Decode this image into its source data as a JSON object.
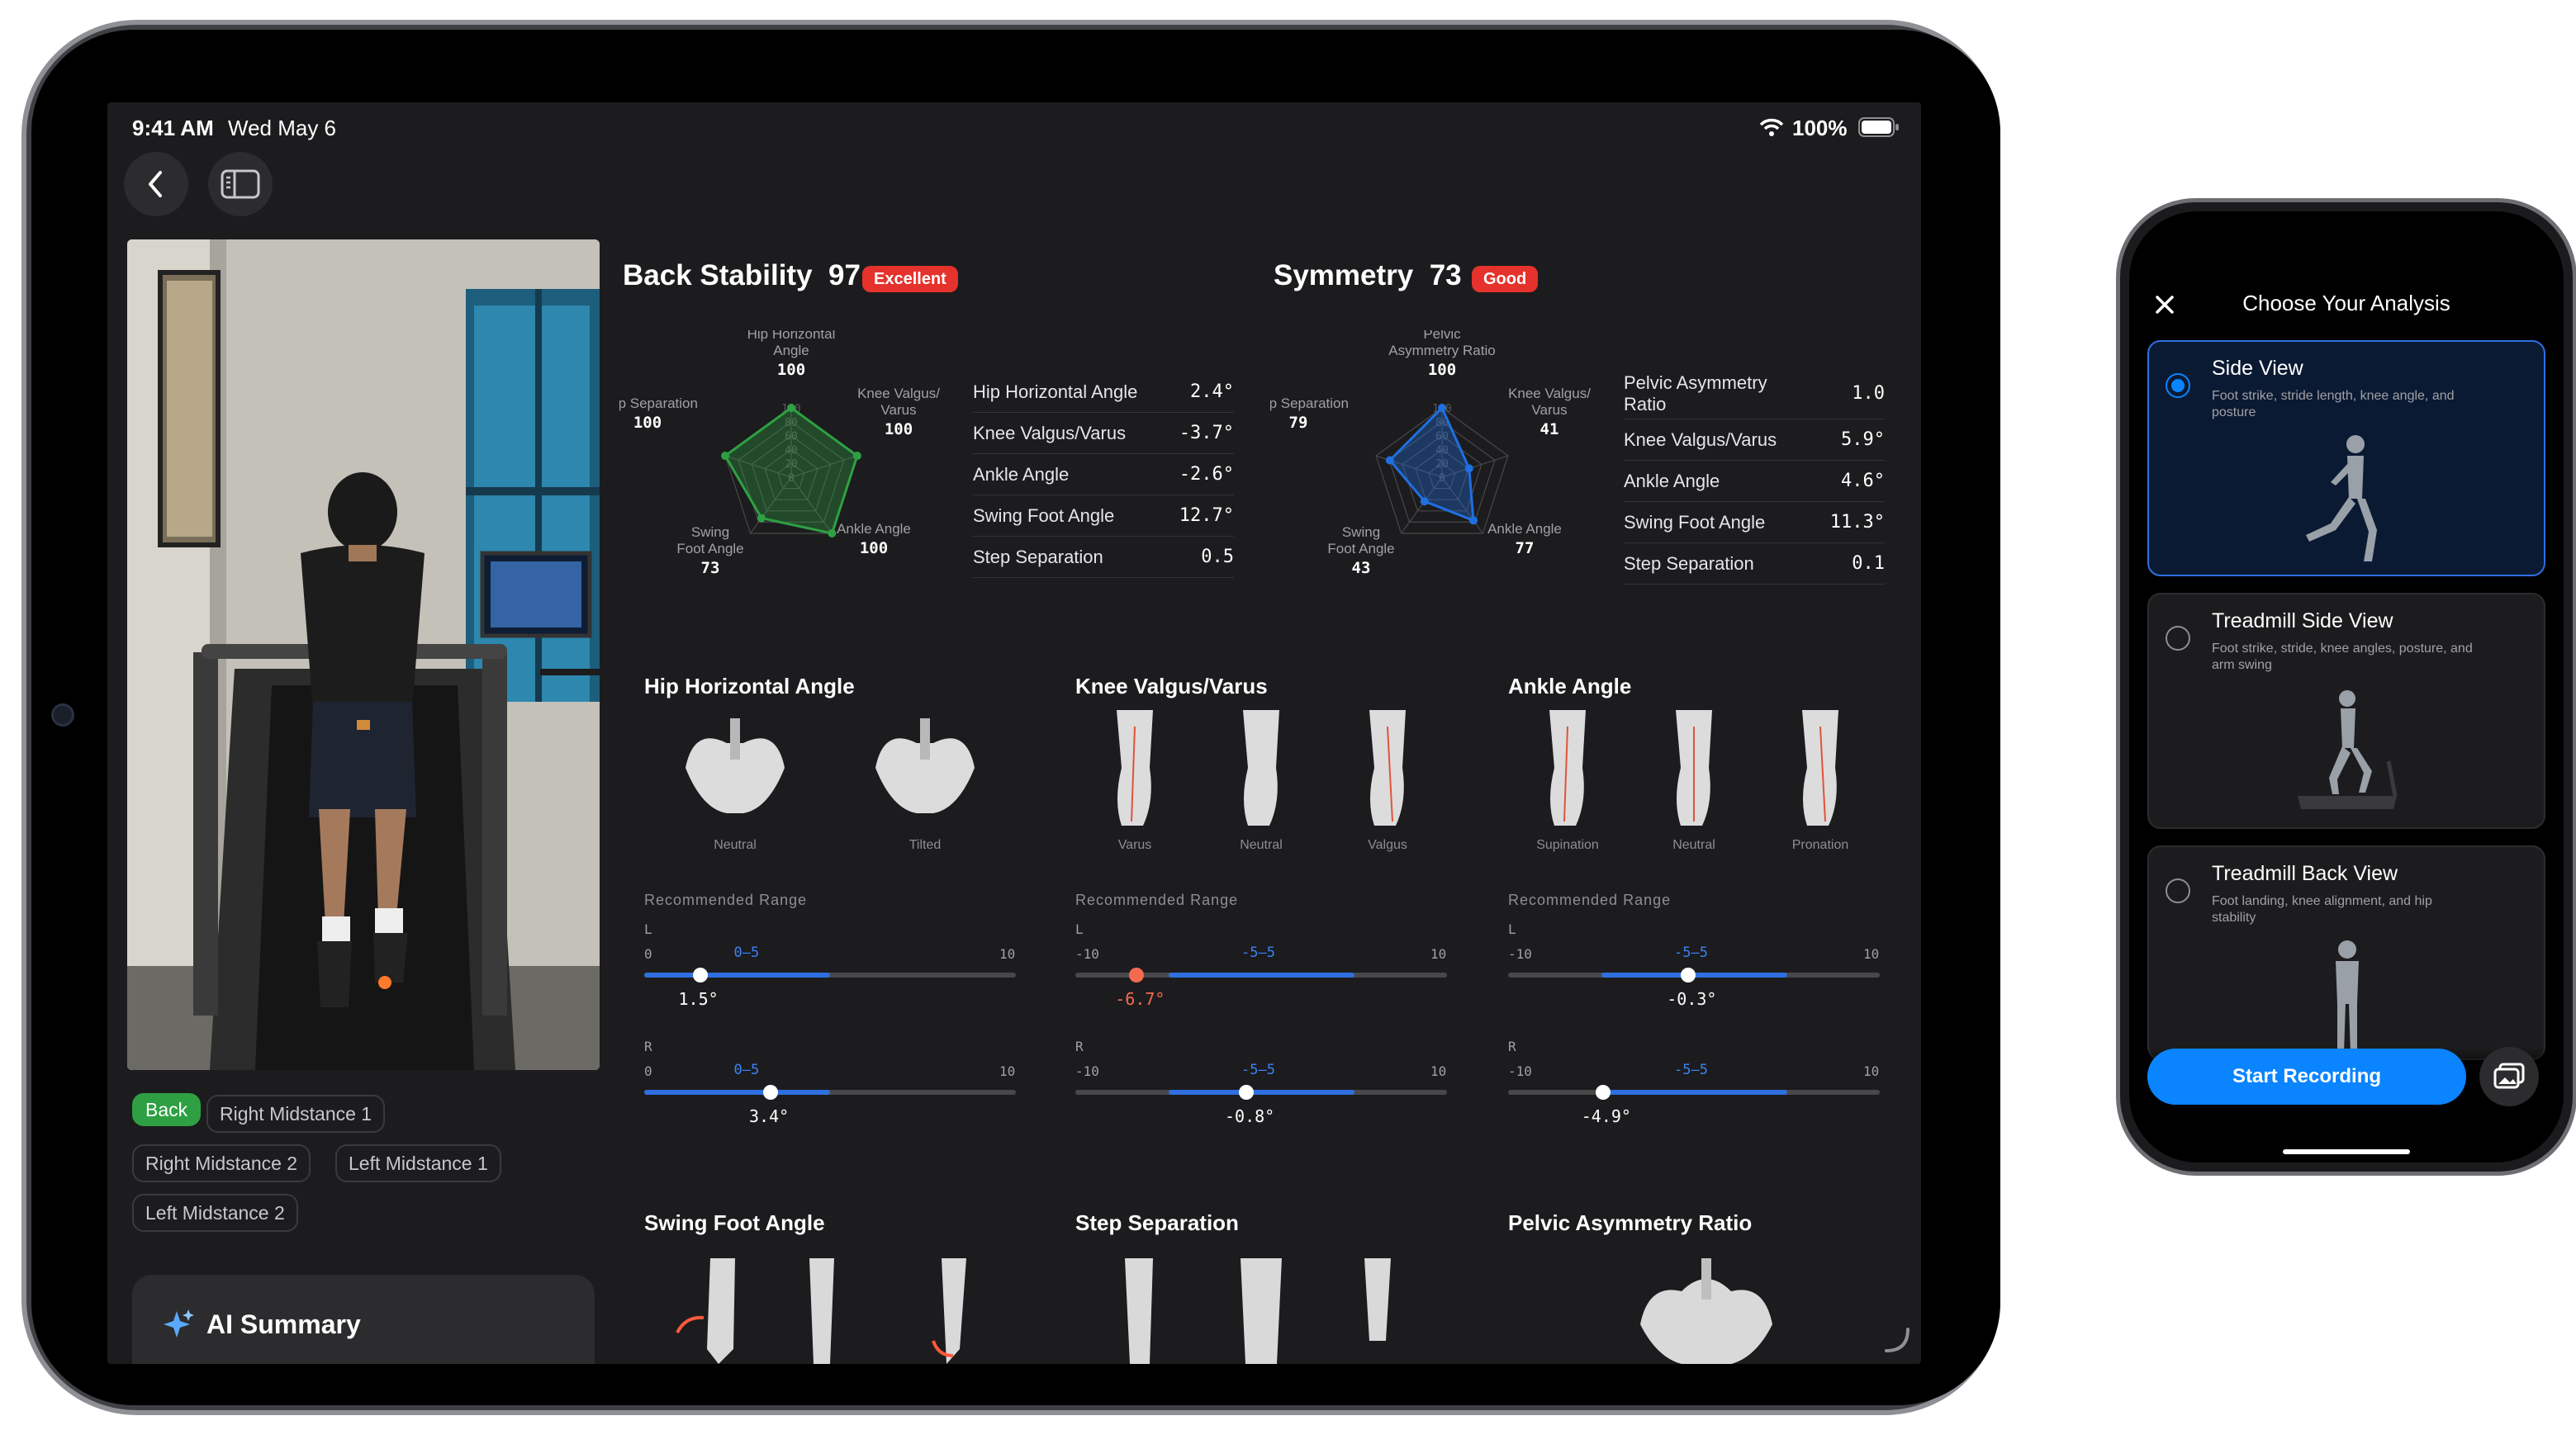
{
  "tablet": {
    "status": {
      "time": "9:41 AM",
      "date": "Wed May 6",
      "battery": "100%"
    },
    "view_chips": [
      {
        "label": "Back",
        "active": true
      },
      {
        "label": "Right Midstance 1",
        "active": false
      },
      {
        "label": "Right Midstance 2",
        "active": false
      },
      {
        "label": "Left Midstance 1",
        "active": false
      },
      {
        "label": "Left Midstance 2",
        "active": false
      }
    ],
    "ai_summary": {
      "title": "AI Summary"
    },
    "back_stability": {
      "title": "Back Stability",
      "score": "97",
      "badge": "Excellent",
      "badge_color": "#e5322c",
      "radar": [
        {
          "label_lines": [
            "Hip Horizontal",
            "Angle"
          ],
          "value": 100
        },
        {
          "label_lines": [
            "Knee Valgus/",
            "Varus"
          ],
          "value": 100
        },
        {
          "label_lines": [
            "Ankle Angle"
          ],
          "value": 100
        },
        {
          "label_lines": [
            "Swing",
            "Foot Angle"
          ],
          "value": 73
        },
        {
          "label_lines": [
            "Step Separation"
          ],
          "value": 100
        }
      ],
      "radar_ticks": [
        "100",
        "80",
        "60",
        "40",
        "20",
        "0"
      ],
      "radar_color": "#2ea043",
      "metrics": [
        {
          "name": "Hip Horizontal Angle",
          "value": "2.4°"
        },
        {
          "name": "Knee Valgus/Varus",
          "value": "-3.7°"
        },
        {
          "name": "Ankle Angle",
          "value": "-2.6°"
        },
        {
          "name": "Swing Foot Angle",
          "value": "12.7°"
        },
        {
          "name": "Step Separation",
          "value": "0.5"
        }
      ]
    },
    "symmetry": {
      "title": "Symmetry",
      "score": "73",
      "badge": "Good",
      "badge_color": "#e5322c",
      "radar": [
        {
          "label_lines": [
            "Pelvic",
            "Asymmetry Ratio"
          ],
          "value": 100
        },
        {
          "label_lines": [
            "Knee Valgus/",
            "Varus"
          ],
          "value": 41
        },
        {
          "label_lines": [
            "Ankle Angle"
          ],
          "value": 77
        },
        {
          "label_lines": [
            "Swing",
            "Foot Angle"
          ],
          "value": 43
        },
        {
          "label_lines": [
            "Step Separation"
          ],
          "value": 79
        }
      ],
      "radar_ticks": [
        "100",
        "80",
        "60",
        "40",
        "20",
        "0"
      ],
      "radar_color": "#1f6fe0",
      "metrics": [
        {
          "name": "Pelvic Asymmetry Ratio",
          "value": "1.0"
        },
        {
          "name": "Knee Valgus/Varus",
          "value": "5.9°"
        },
        {
          "name": "Ankle Angle",
          "value": "4.6°"
        },
        {
          "name": "Swing Foot Angle",
          "value": "11.3°"
        },
        {
          "name": "Step Separation",
          "value": "0.1"
        }
      ]
    },
    "range_label": "Recommended Range",
    "detail_sections": [
      {
        "title": "Hip Horizontal Angle",
        "captions": [
          "Neutral",
          "Tilted"
        ],
        "sides": [
          {
            "side": "L",
            "min": "0",
            "max": "10",
            "range": "0–5",
            "value": "1.5°",
            "pos": 0.15,
            "range_lo": 0,
            "range_hi": 0.5,
            "out": false
          },
          {
            "side": "R",
            "min": "0",
            "max": "10",
            "range": "0–5",
            "value": "3.4°",
            "pos": 0.34,
            "range_lo": 0,
            "range_hi": 0.5,
            "out": false
          }
        ]
      },
      {
        "title": "Knee Valgus/Varus",
        "captions": [
          "Varus",
          "Neutral",
          "Valgus"
        ],
        "sides": [
          {
            "side": "L",
            "min": "-10",
            "max": "10",
            "range": "-5–5",
            "value": "-6.7°",
            "pos": 0.165,
            "range_lo": 0.25,
            "range_hi": 0.75,
            "out": true
          },
          {
            "side": "R",
            "min": "-10",
            "max": "10",
            "range": "-5–5",
            "value": "-0.8°",
            "pos": 0.46,
            "range_lo": 0.25,
            "range_hi": 0.75,
            "out": false
          }
        ]
      },
      {
        "title": "Ankle Angle",
        "captions": [
          "Supination",
          "Neutral",
          "Pronation"
        ],
        "sides": [
          {
            "side": "L",
            "min": "-10",
            "max": "10",
            "range": "-5–5",
            "value": "-0.3°",
            "pos": 0.485,
            "range_lo": 0.25,
            "range_hi": 0.75,
            "out": false
          },
          {
            "side": "R",
            "min": "-10",
            "max": "10",
            "range": "-5–5",
            "value": "-4.9°",
            "pos": 0.255,
            "range_lo": 0.25,
            "range_hi": 0.75,
            "out": false
          }
        ]
      }
    ],
    "bottom_sections": [
      "Swing Foot Angle",
      "Step Separation",
      "Pelvic Asymmetry Ratio"
    ]
  },
  "phone": {
    "title": "Choose Your Analysis",
    "options": [
      {
        "title": "Side View",
        "desc": "Foot strike, stride length, knee angle, and posture",
        "selected": true
      },
      {
        "title": "Treadmill Side View",
        "desc": "Foot strike, stride, knee angles, posture, and arm swing",
        "selected": false
      },
      {
        "title": "Treadmill Back View",
        "desc": "Foot landing, knee alignment, and hip stability",
        "selected": false
      }
    ],
    "cta": "Start Recording"
  },
  "colors": {
    "accent": "#0a84ff",
    "good": "#2ea043",
    "bad": "#e5322c",
    "bar": "#2f6fe0"
  }
}
